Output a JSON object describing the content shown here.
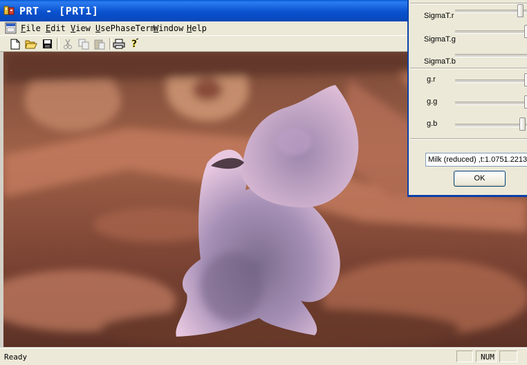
{
  "window": {
    "title": "PRT - [PRT1]"
  },
  "menu": {
    "items": [
      "File",
      "Edit",
      "View",
      "UsePhaseTerm",
      "Window",
      "Help"
    ]
  },
  "toolbar": {
    "buttons": [
      "new-icon",
      "open-icon",
      "save-icon",
      "cut-icon",
      "copy-icon",
      "paste-icon",
      "print-icon",
      "help-icon"
    ]
  },
  "dialog": {
    "sliders": [
      {
        "label": "SigmaT.r"
      },
      {
        "label": "SigmaT.g"
      },
      {
        "label": "SigmaT.b"
      },
      {
        "label": "g.r"
      },
      {
        "label": "g.g"
      },
      {
        "label": "g.b"
      }
    ],
    "material_value": "Milk (reduced) ,t:1.0751.2213",
    "ok_label": "OK"
  },
  "status": {
    "text": "Ready",
    "num": "NUM"
  },
  "colors": {
    "titlebar": "#0a52cf",
    "chrome": "#ece9d8",
    "dialog_frame": "#0a3fa8"
  }
}
